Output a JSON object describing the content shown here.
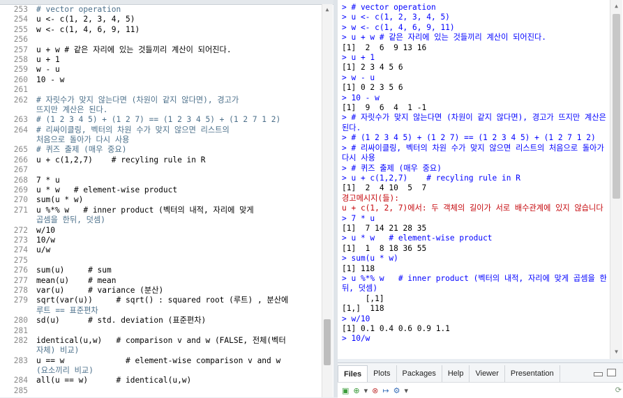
{
  "editor": {
    "lines": [
      {
        "num": "253",
        "text": "# vector operation",
        "kind": "comment"
      },
      {
        "num": "254",
        "text": "u <- c(1, 2, 3, 4, 5)",
        "kind": "code"
      },
      {
        "num": "255",
        "text": "w <- c(1, 4, 6, 9, 11)",
        "kind": "code"
      },
      {
        "num": "256",
        "text": "",
        "kind": "code"
      },
      {
        "num": "257",
        "text": "u + w # 같은 자리에 있는 것들끼리 계산이 되어진다.",
        "kind": "code"
      },
      {
        "num": "258",
        "text": "u + 1",
        "kind": "code"
      },
      {
        "num": "259",
        "text": "w - u",
        "kind": "code"
      },
      {
        "num": "260",
        "text": "10 - w",
        "kind": "code"
      },
      {
        "num": "261",
        "text": "",
        "kind": "code"
      },
      {
        "num": "262",
        "text": "# 자릿수가 맞지 않는다면 (차원이 같지 않다면), 경고가",
        "kind": "comment"
      },
      {
        "num": "",
        "text": "뜨지만 계산은 된다.",
        "kind": "comment"
      },
      {
        "num": "263",
        "text": "# (1 2 3 4 5) + (1 2 7) == (1 2 3 4 5) + (1 2 7 1 2)",
        "kind": "comment"
      },
      {
        "num": "264",
        "text": "# 리싸이클링, 벡터의 차원 수가 맞지 않으면 리스트의",
        "kind": "comment"
      },
      {
        "num": "",
        "text": "처음으로 돌아가 다시 사용",
        "kind": "comment"
      },
      {
        "num": "265",
        "text": "# 퀴즈 출제 (매우 중요)",
        "kind": "comment"
      },
      {
        "num": "266",
        "text": "u + c(1,2,7)    # recyling rule in R",
        "kind": "code"
      },
      {
        "num": "267",
        "text": "",
        "kind": "code"
      },
      {
        "num": "268",
        "text": "7 * u",
        "kind": "code"
      },
      {
        "num": "269",
        "text": "u * w   # element-wise product",
        "kind": "code"
      },
      {
        "num": "270",
        "text": "sum(u * w)",
        "kind": "code"
      },
      {
        "num": "271",
        "text": "u %*% w   # inner product (벡터의 내적, 자리에 맞게",
        "kind": "code"
      },
      {
        "num": "",
        "text": "곱셈을 한뒤, 덧셈)",
        "kind": "comment"
      },
      {
        "num": "272",
        "text": "w/10",
        "kind": "code"
      },
      {
        "num": "273",
        "text": "10/w",
        "kind": "code"
      },
      {
        "num": "274",
        "text": "u/w",
        "kind": "code"
      },
      {
        "num": "275",
        "text": "",
        "kind": "code"
      },
      {
        "num": "276",
        "text": "sum(u)     # sum",
        "kind": "code"
      },
      {
        "num": "277",
        "text": "mean(u)    # mean",
        "kind": "code"
      },
      {
        "num": "278",
        "text": "var(u)     # variance (분산)",
        "kind": "code"
      },
      {
        "num": "279",
        "text": "sqrt(var(u))     # sqrt() : squared root (루트) , 분산에",
        "kind": "code"
      },
      {
        "num": "",
        "text": "루트 == 표준편차",
        "kind": "comment"
      },
      {
        "num": "280",
        "text": "sd(u)      # std. deviation (표준편차)",
        "kind": "code"
      },
      {
        "num": "281",
        "text": "",
        "kind": "code"
      },
      {
        "num": "282",
        "text": "identical(u,w)   # comparison v and w (FALSE, 전체(벡터",
        "kind": "code"
      },
      {
        "num": "",
        "text": "자체) 비교)",
        "kind": "comment"
      },
      {
        "num": "283",
        "text": "u == w             # element-wise comparison v and w",
        "kind": "code"
      },
      {
        "num": "",
        "text": "(요소끼리 비교)",
        "kind": "comment"
      },
      {
        "num": "284",
        "text": "all(u == w)      # identical(u,w)",
        "kind": "code"
      },
      {
        "num": "285",
        "text": "",
        "kind": "code"
      }
    ]
  },
  "console": {
    "lines": [
      {
        "text": "> # vector operation",
        "kind": "input"
      },
      {
        "text": "> u <- c(1, 2, 3, 4, 5)",
        "kind": "input"
      },
      {
        "text": "> w <- c(1, 4, 6, 9, 11)",
        "kind": "input"
      },
      {
        "text": "> u + w # 같은 자리에 있는 것들끼리 계산이 되어진다.",
        "kind": "input"
      },
      {
        "text": "[1]  2  6  9 13 16",
        "kind": "output"
      },
      {
        "text": "> u + 1",
        "kind": "input"
      },
      {
        "text": "[1] 2 3 4 5 6",
        "kind": "output"
      },
      {
        "text": "> w - u",
        "kind": "input"
      },
      {
        "text": "[1] 0 2 3 5 6",
        "kind": "output"
      },
      {
        "text": "> 10 - w",
        "kind": "input"
      },
      {
        "text": "[1]  9  6  4  1 -1",
        "kind": "output"
      },
      {
        "text": "> # 자릿수가 맞지 않는다면 (차원이 같지 않다면), 경고가 뜨지만 계산은 된다.",
        "kind": "input"
      },
      {
        "text": "> # (1 2 3 4 5) + (1 2 7) == (1 2 3 4 5) + (1 2 7 1 2)",
        "kind": "input"
      },
      {
        "text": "> # 리싸이클링, 벡터의 차원 수가 맞지 않으면 리스트의 처음으로 돌아가 다시 사용",
        "kind": "input"
      },
      {
        "text": "> # 퀴즈 출제 (매우 중요)",
        "kind": "input"
      },
      {
        "text": "> u + c(1,2,7)    # recyling rule in R",
        "kind": "input"
      },
      {
        "text": "[1]  2  4 10  5  7",
        "kind": "output"
      },
      {
        "text": "경고메시지(들):",
        "kind": "error"
      },
      {
        "text": "u + c(1, 2, 7)에서: 두 객체의 길이가 서로 배수관계에 있지 않습니다",
        "kind": "error"
      },
      {
        "text": "> 7 * u",
        "kind": "input"
      },
      {
        "text": "[1]  7 14 21 28 35",
        "kind": "output"
      },
      {
        "text": "> u * w   # element-wise product",
        "kind": "input"
      },
      {
        "text": "[1]  1  8 18 36 55",
        "kind": "output"
      },
      {
        "text": "> sum(u * w)",
        "kind": "input"
      },
      {
        "text": "[1] 118",
        "kind": "output"
      },
      {
        "text": "> u %*% w   # inner product (벡터의 내적, 자리에 맞게 곱셈을 한뒤, 덧셈)",
        "kind": "input"
      },
      {
        "text": "     [,1]",
        "kind": "output"
      },
      {
        "text": "[1,]  118",
        "kind": "output"
      },
      {
        "text": "> w/10",
        "kind": "input"
      },
      {
        "text": "[1] 0.1 0.4 0.6 0.9 1.1",
        "kind": "output"
      },
      {
        "text": "> 10/w",
        "kind": "input"
      }
    ]
  },
  "files_pane": {
    "tabs": [
      "Files",
      "Plots",
      "Packages",
      "Help",
      "Viewer",
      "Presentation"
    ],
    "active_tab": "Files"
  },
  "colors": {
    "console_input": "#0000ff",
    "console_error": "#c5060b",
    "editor_comment": "#4b6f8a"
  }
}
